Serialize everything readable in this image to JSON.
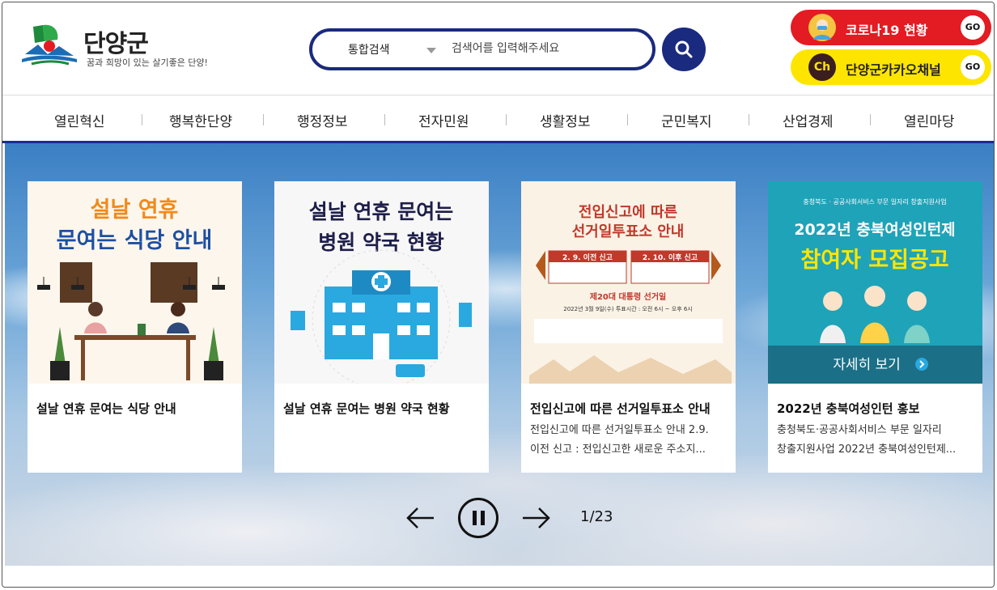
{
  "header": {
    "logo_name": "단양군",
    "logo_slogan": "꿈과 희망이 있는 살기좋은 단양!",
    "search": {
      "type_label": "통합검색",
      "placeholder": "검색어를 입력해주세요"
    },
    "quick_links": [
      {
        "label": "코로나19 현황",
        "go": "GO",
        "icon": "mask-person-icon",
        "color": "#e31b23"
      },
      {
        "label": "단양군카카오채널",
        "go": "GO",
        "icon": "kakao-channel-icon",
        "color": "#fde500",
        "icon_text": "Ch"
      }
    ]
  },
  "nav": {
    "items": [
      "열린혁신",
      "행복한단양",
      "행정정보",
      "전자민원",
      "생활정보",
      "군민복지",
      "산업경제",
      "열린마당"
    ]
  },
  "slider": {
    "cards": [
      {
        "image_lines": [
          "설날 연휴",
          "문여는 식당 안내"
        ],
        "title": "설날 연휴 문여는 식당 안내",
        "desc": []
      },
      {
        "image_lines": [
          "설날 연휴 문여는",
          "병원 약국 현황"
        ],
        "title": "설날 연휴 문여는 병원 약국 현황",
        "desc": []
      },
      {
        "image_lines": [
          "전입신고에 따른",
          "선거일투표소 안내",
          "2. 9. 이전 신고",
          "2. 10. 이후 신고",
          "제20대 대통령 선거일",
          "2022년 3월 9일(수) 투표시간 : 오전 6시 ~ 오후 6시"
        ],
        "title": "전입신고에 따른 선거일투표소 안내",
        "desc": [
          "전입신고에 따른 선거일투표소 안내 2.9.",
          "이전 신고 : 전입신고한 새로운 주소지..."
        ]
      },
      {
        "image_lines": [
          "충청북도 · 공공사회서비스 부문 일자리 창출지원사업",
          "2022년 충북여성인턴제",
          "참여자 모집공고",
          "자세히 보기"
        ],
        "title": "2022년 충북여성인턴 홍보",
        "desc": [
          "충청북도·공공사회서비스 부문 일자리",
          "창출지원사업 2022년 충북여성인턴제..."
        ]
      }
    ],
    "pager": "1/23"
  }
}
